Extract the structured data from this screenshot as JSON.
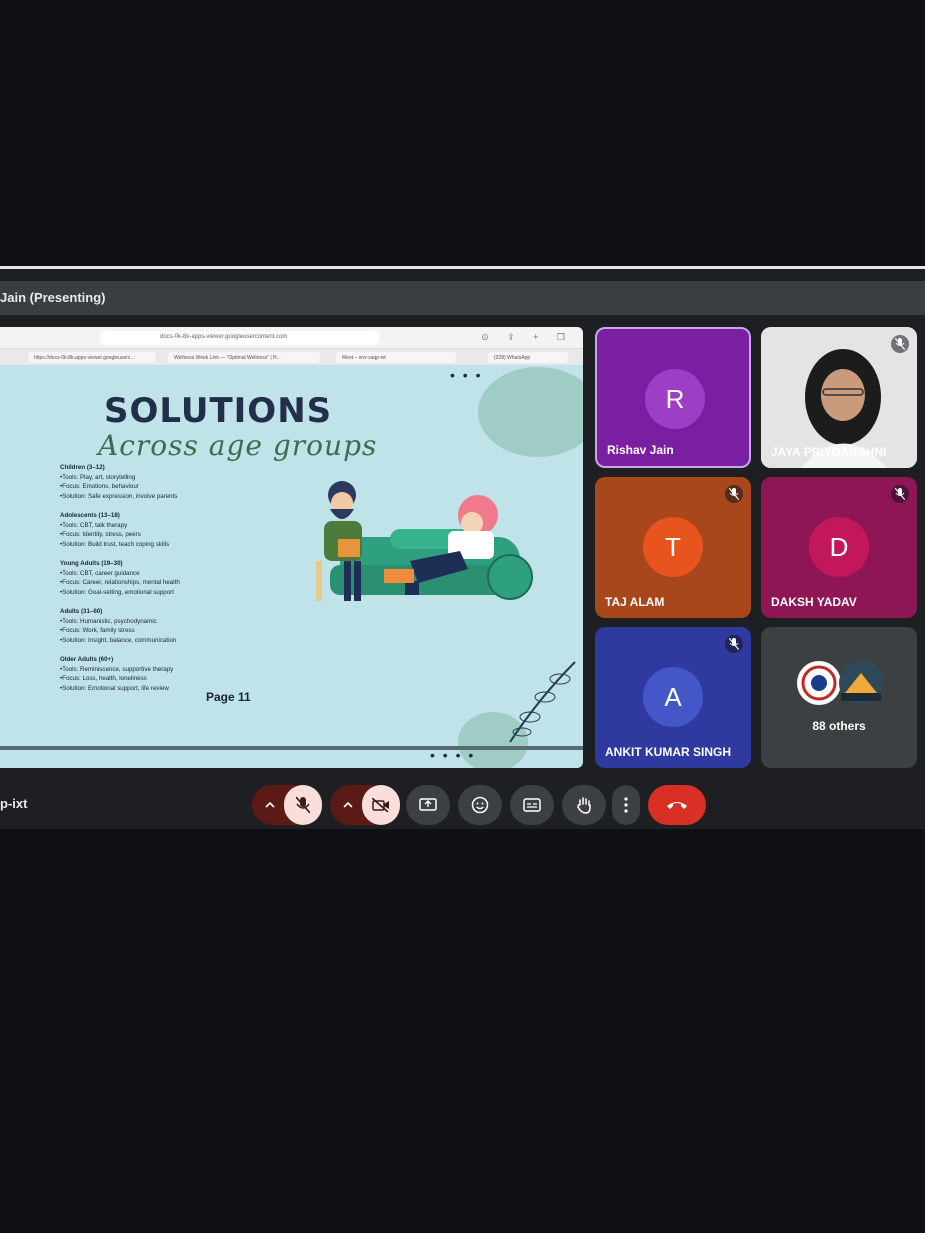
{
  "header": {
    "presenting_label": "Jain (Presenting)"
  },
  "browser": {
    "url": "docs-0k-8k-apps-viewer.googleusercontent.com",
    "tabs": [
      "https://docs-0k-8k-apps-viewer.googleuserc...",
      "Wellness Week Link — \"Optimal Wellness\" | H...",
      "Meet – xnv-vaqp-ixt",
      "(228) WhatsApp"
    ]
  },
  "slide": {
    "title": "SOLUTIONS",
    "subtitle": "Across age groups",
    "sections": [
      {
        "heading": "Children (3–12)",
        "lines": [
          "•Tools: Play, art, storytelling",
          "•Focus: Emotions, behaviour",
          "•Solution: Safe expression, involve parents"
        ]
      },
      {
        "heading": "Adolescents (13–18)",
        "lines": [
          "•Tools: CBT, talk therapy",
          "•Focus: Identity, stress, peers",
          "•Solution: Build trust, teach coping skills"
        ]
      },
      {
        "heading": "Young Adults (19–30)",
        "lines": [
          "•Tools: CBT, career guidance",
          "•Focus: Career, relationships, mental health",
          "•Solution: Goal-setting, emotional support"
        ]
      },
      {
        "heading": "Adults (31–60)",
        "lines": [
          "•Tools: Humanistic, psychodynamic",
          "•Focus: Work, family stress",
          "•Solution: Insight, balance, communication"
        ]
      },
      {
        "heading": "Older Adults (60+)",
        "lines": [
          "•Tools: Reminiscence, supportive therapy",
          "•Focus: Loss, health, loneliness",
          "•Solution: Emotional support, life review"
        ]
      }
    ],
    "page": "Page 11"
  },
  "participants": [
    {
      "initial": "R",
      "name": "Rishav Jain",
      "bg": "#7b1fa2",
      "avatar": "#9c3fc6",
      "muted": false,
      "speaking": true
    },
    {
      "initial": "",
      "name": "JAYA PRIYDARSHNI",
      "bg": "#e9e9e9",
      "muted": true,
      "video": true
    },
    {
      "initial": "T",
      "name": "TAJ ALAM",
      "bg": "#a8461c",
      "avatar": "#e8541e",
      "muted": true
    },
    {
      "initial": "D",
      "name": "DAKSH YADAV",
      "bg": "#8e1655",
      "avatar": "#c2185b",
      "muted": true
    },
    {
      "initial": "A",
      "name": "ANKIT KUMAR SINGH",
      "bg": "#2f3aa0",
      "avatar": "#4556c9",
      "muted": true
    },
    {
      "initial": "",
      "name": "88 others",
      "bg": "#3c4043",
      "muted": false,
      "others": true
    }
  ],
  "controls": {
    "meeting_code": "p-ixt",
    "buttons": [
      "mic-options",
      "mic-off",
      "camera-options",
      "camera-off",
      "present",
      "reactions",
      "captions",
      "raise-hand",
      "more-options",
      "leave-call"
    ]
  },
  "colors": {
    "leave": "#d93025",
    "mic_off_bg": "#f9dedc",
    "options_bg": "#5c1a17"
  }
}
